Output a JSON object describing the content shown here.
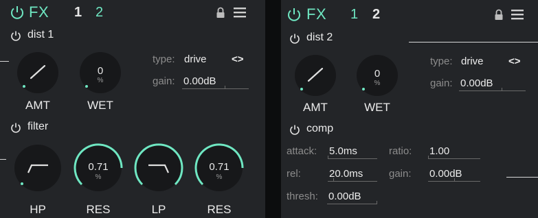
{
  "colors": {
    "accent": "#6fe7c2",
    "panel_bg": "#232528",
    "gap_bg": "#0c0d0e"
  },
  "left": {
    "fx_title": "FX",
    "tabs": [
      "1",
      "2"
    ],
    "active_tab": "1",
    "dist": {
      "title": "dist 1",
      "amt": {
        "label": "AMT",
        "level": 0.0
      },
      "wet": {
        "label": "WET",
        "value": "0",
        "unit": "%",
        "level": 0.0
      },
      "type_label": "type:",
      "type_value": "drive",
      "cycle": "<>",
      "gain_label": "gain:",
      "gain_value": "0.00dB"
    },
    "filter": {
      "title": "filter",
      "hp": {
        "label": "HP",
        "level": 0.0
      },
      "res1": {
        "label": "RES",
        "value": "0.71",
        "unit": "%",
        "level": 0.71
      },
      "lp": {
        "label": "LP",
        "level": 1.0
      },
      "res2": {
        "label": "RES",
        "value": "0.71",
        "unit": "%",
        "level": 0.71
      }
    }
  },
  "right": {
    "fx_title": "FX",
    "tabs": [
      "1",
      "2"
    ],
    "active_tab": "2",
    "dist": {
      "title": "dist 2",
      "amt": {
        "label": "AMT",
        "level": 0.0
      },
      "wet": {
        "label": "WET",
        "value": "0",
        "unit": "%",
        "level": 0.0
      },
      "type_label": "type:",
      "type_value": "drive",
      "cycle": "<>",
      "gain_label": "gain:",
      "gain_value": "0.00dB"
    },
    "comp": {
      "title": "comp",
      "attack_label": "attack:",
      "attack_value": "5.0ms",
      "ratio_label": "ratio:",
      "ratio_value": "1.00",
      "rel_label": "rel:",
      "rel_value": "20.0ms",
      "gain_label": "gain:",
      "gain_value": "0.00dB",
      "thresh_label": "thresh:",
      "thresh_value": "0.00dB"
    }
  }
}
